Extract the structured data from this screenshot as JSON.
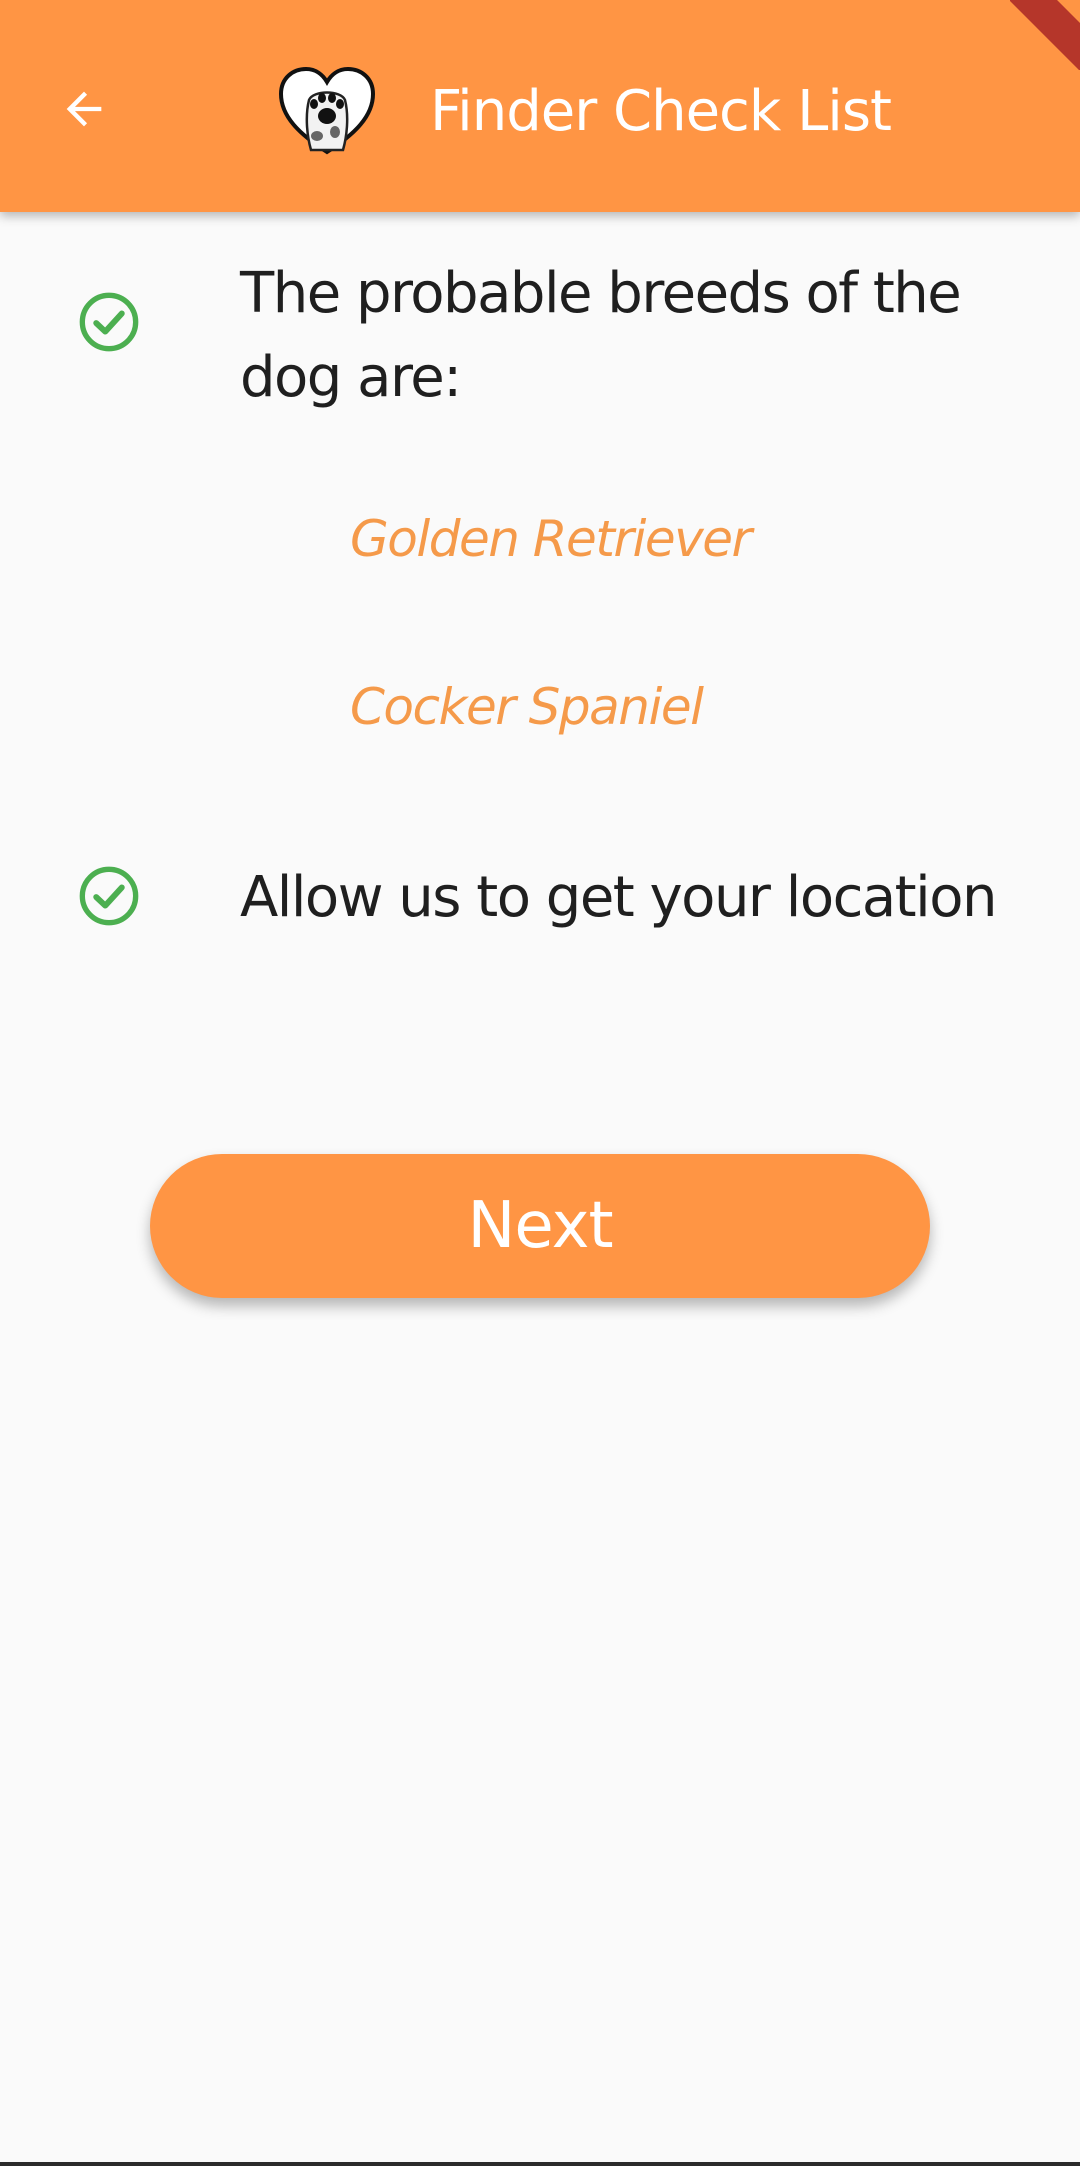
{
  "app_bar": {
    "title": "Finder Check List",
    "back_icon": "arrow-left-icon",
    "logo": "heart-paw-logo",
    "color": "#ff9544"
  },
  "checklist": {
    "items": [
      {
        "text": "The probable breeds of the dog are:",
        "status_icon": "check-circle-icon",
        "breeds": [
          "Golden Retriever",
          "Cocker Spaniel"
        ]
      },
      {
        "text": "Allow us to get your location",
        "status_icon": "check-circle-icon"
      }
    ],
    "check_color": "#4caf50",
    "breed_color": "#f59a4a"
  },
  "actions": {
    "next_label": "Next"
  }
}
